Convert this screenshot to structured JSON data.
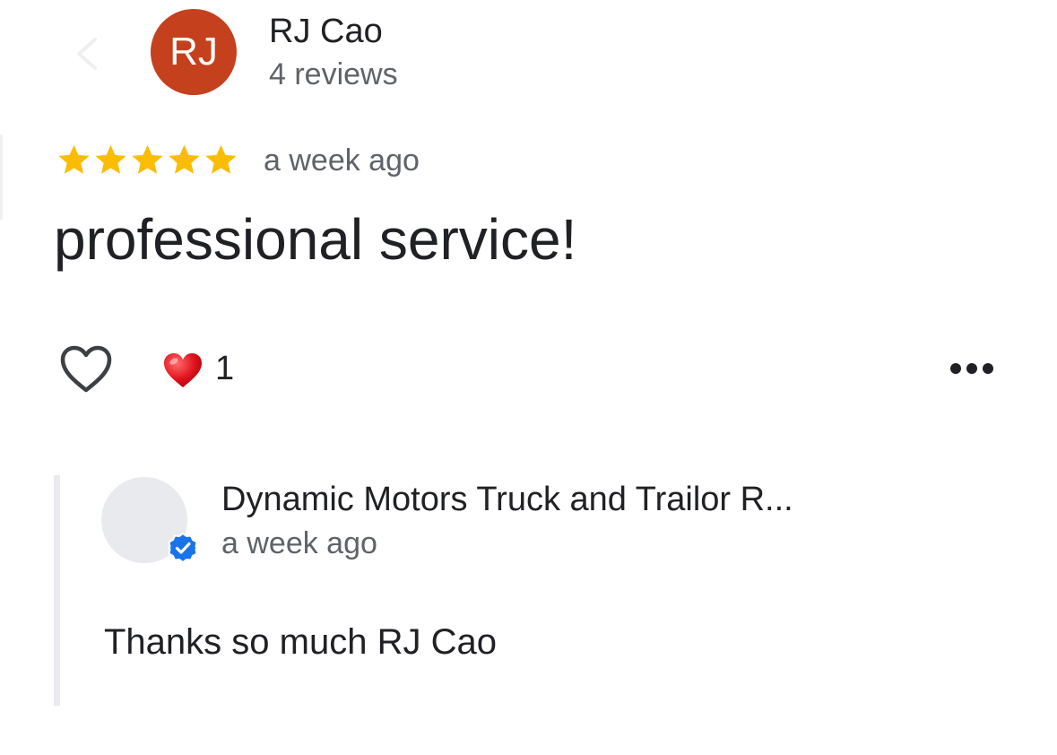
{
  "reviewer": {
    "initials": "RJ",
    "name": "RJ Cao",
    "reviews": "4 reviews",
    "avatar_color": "#c5401d"
  },
  "review": {
    "rating": 5,
    "max_rating": 5,
    "time": "a week ago",
    "text": "professional service!",
    "star_color": "#fbbc04"
  },
  "actions": {
    "like_icon": "heart-outline-icon",
    "reaction_icon": "red-heart-icon",
    "reaction_count": "1",
    "more_icon": "more-horizontal-icon"
  },
  "owner_response": {
    "name": "Dynamic Motors Truck and Trailor R...",
    "time": "a week ago",
    "text": "Thanks so much RJ Cao",
    "badge_icon": "verified-badge-icon",
    "badge_color": "#1a73e8"
  }
}
